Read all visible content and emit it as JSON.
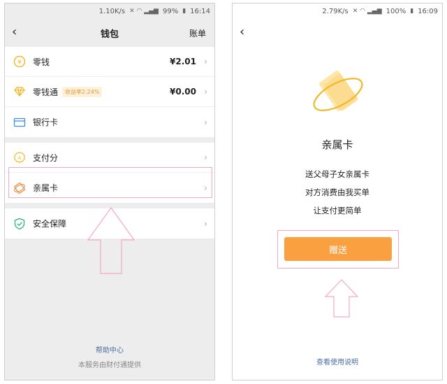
{
  "left": {
    "status": {
      "speed": "1.10K/s",
      "battery": "99%",
      "time": "16:14"
    },
    "nav": {
      "title": "钱包",
      "right": "账单"
    },
    "group1": [
      {
        "label": "零钱",
        "value": "¥2.01",
        "icon": "coin-icon"
      },
      {
        "label": "零钱通",
        "badge": "收益率2.24%",
        "value": "¥0.00",
        "icon": "diamond-icon"
      },
      {
        "label": "银行卡",
        "icon": "bank-card-icon"
      }
    ],
    "group2": [
      {
        "label": "支付分",
        "icon": "score-icon"
      },
      {
        "label": "亲属卡",
        "icon": "family-card-icon"
      }
    ],
    "group3": [
      {
        "label": "安全保障",
        "icon": "shield-icon"
      }
    ],
    "footer": {
      "help": "帮助中心",
      "provider": "本服务由财付通提供"
    }
  },
  "right": {
    "status": {
      "speed": "2.79K/s",
      "battery": "100%",
      "time": "16:09"
    },
    "title": "亲属卡",
    "lines": [
      "送父母子女亲属卡",
      "对方消费由我买单",
      "让支付更简单"
    ],
    "button": "赠送",
    "footer_link": "查看使用说明"
  },
  "colors": {
    "accent": "#fba040",
    "highlight": "#f5a9bc",
    "link": "#4a6da0"
  }
}
